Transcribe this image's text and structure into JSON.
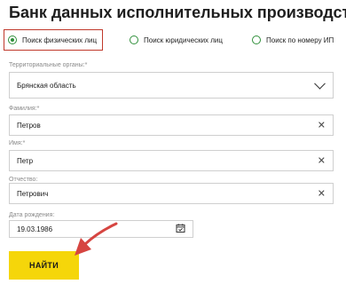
{
  "page": {
    "title": "Банк данных исполнительных производств"
  },
  "search_modes": [
    {
      "label": "Поиск физических лиц",
      "selected": true
    },
    {
      "label": "Поиск юридических лиц",
      "selected": false
    },
    {
      "label": "Поиск по номеру ИП",
      "selected": false
    }
  ],
  "form": {
    "region": {
      "label": "Территориальные органы:*",
      "value": "Брянская область",
      "icon": "chevron-down-icon"
    },
    "last_name": {
      "label": "Фамилия:*",
      "value": "Петров",
      "icon": "close-icon"
    },
    "first_name": {
      "label": "Имя:*",
      "value": "Петр",
      "icon": "close-icon"
    },
    "middle_name": {
      "label": "Отчество:",
      "value": "Петрович",
      "icon": "close-icon"
    },
    "birth_date": {
      "label": "Дата рождения:",
      "value": "19.03.1986",
      "icon": "calendar-icon"
    }
  },
  "actions": {
    "search_label": "НАЙТИ"
  },
  "colors": {
    "accent_green": "#2f8f3a",
    "highlight_red": "#c0392b",
    "button_yellow": "#f5d60a"
  }
}
